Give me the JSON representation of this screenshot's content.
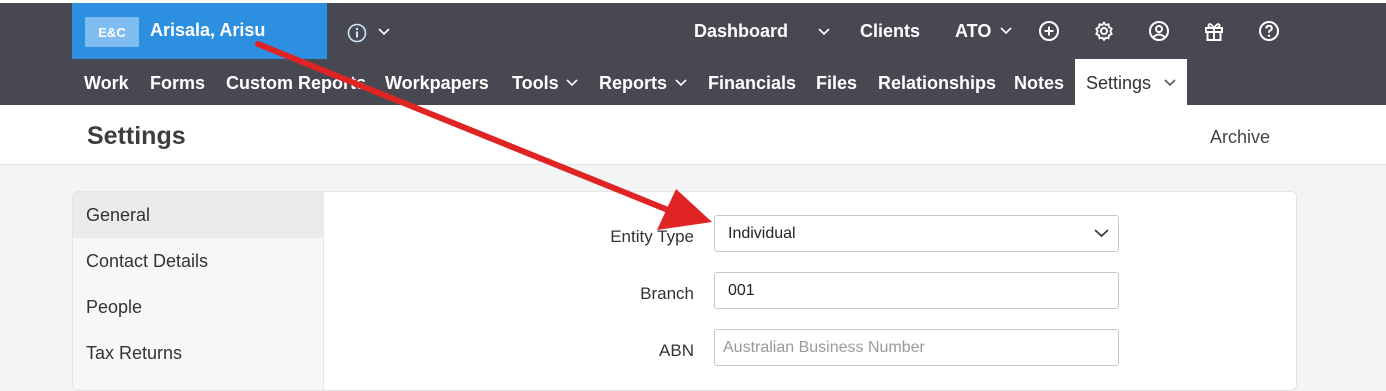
{
  "client": {
    "logo_text": "E&C",
    "name": "Arisala, Arisu"
  },
  "topnav": {
    "dashboard": "Dashboard",
    "clients": "Clients",
    "ato": "ATO"
  },
  "icons": {
    "add": "plus-circle-icon",
    "settings": "gear-icon",
    "account": "user-circle-icon",
    "gift": "gift-icon",
    "help": "question-circle-icon"
  },
  "secnav": {
    "work": "Work",
    "forms": "Forms",
    "custom_reports": "Custom Reports",
    "workpapers": "Workpapers",
    "tools": "Tools",
    "reports": "Reports",
    "financials": "Financials",
    "files": "Files",
    "relationships": "Relationships",
    "notes": "Notes",
    "settings": "Settings"
  },
  "page": {
    "title": "Settings",
    "archive": "Archive"
  },
  "sidebar": {
    "items": [
      "General",
      "Contact Details",
      "People",
      "Tax Returns"
    ]
  },
  "form": {
    "entity_type_label": "Entity Type",
    "entity_type_value": "Individual",
    "branch_label": "Branch",
    "branch_value": "001",
    "abn_label": "ABN",
    "abn_placeholder": "Australian Business Number"
  },
  "colors": {
    "nav_bg": "#474852",
    "client_blue": "#2d8fe0",
    "annotation_arrow": "#e02424"
  }
}
